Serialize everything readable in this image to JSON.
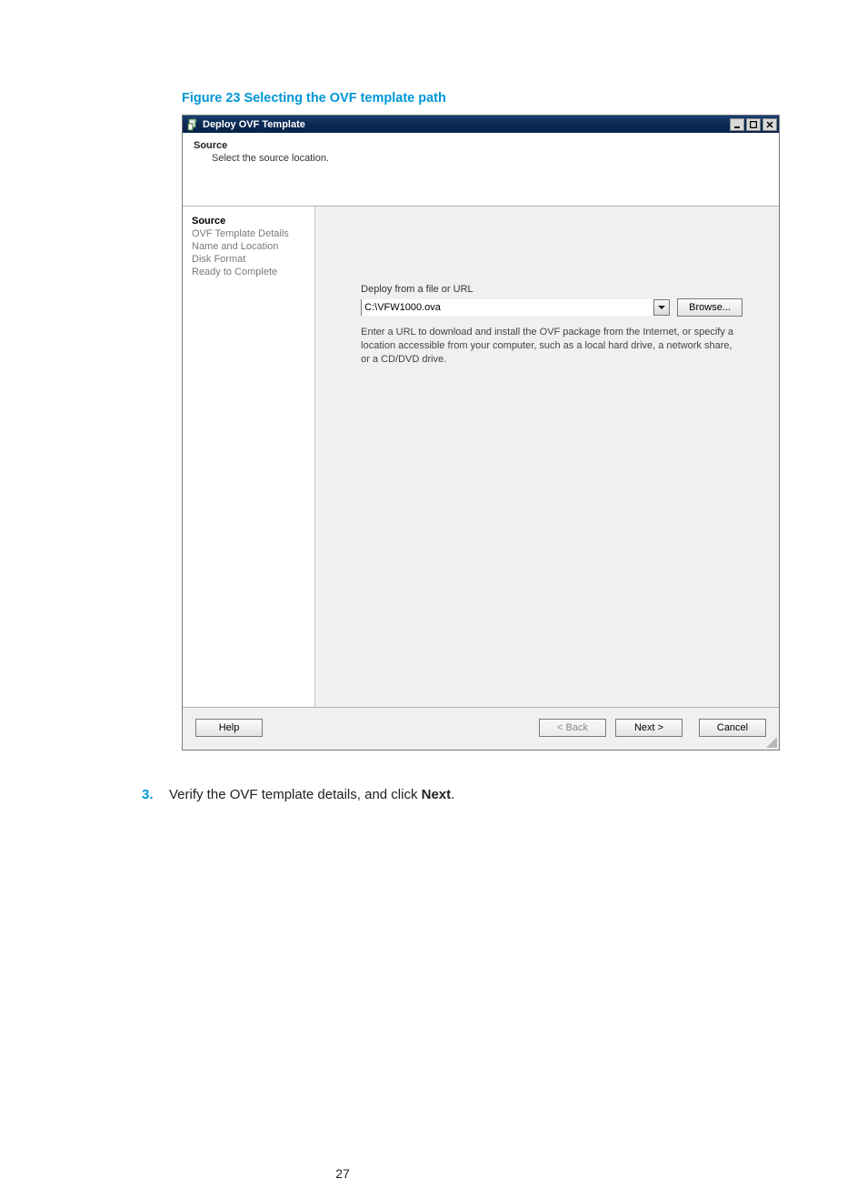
{
  "figure_caption": "Figure 23 Selecting the OVF template path",
  "dialog": {
    "title": "Deploy OVF Template",
    "header": {
      "title": "Source",
      "subtitle": "Select the source location."
    },
    "sidebar": {
      "steps": [
        {
          "label": "Source",
          "active": true
        },
        {
          "label": "OVF Template Details",
          "active": false
        },
        {
          "label": "Name and Location",
          "active": false
        },
        {
          "label": "Disk Format",
          "active": false
        },
        {
          "label": "Ready to Complete",
          "active": false
        }
      ]
    },
    "main": {
      "field_label": "Deploy from a file or URL",
      "path_value": "C:\\VFW1000.ova",
      "browse_label": "Browse...",
      "hint": "Enter a URL to download and install the OVF package from the Internet, or specify a location accessible from your computer, such as a local hard drive, a network share, or a CD/DVD drive."
    },
    "footer": {
      "help": "Help",
      "back": "< Back",
      "next": "Next >",
      "cancel": "Cancel"
    }
  },
  "step": {
    "number": "3",
    "text_before": "Verify the OVF template details, and click ",
    "text_bold": "Next",
    "text_after": "."
  },
  "page_number": "27"
}
